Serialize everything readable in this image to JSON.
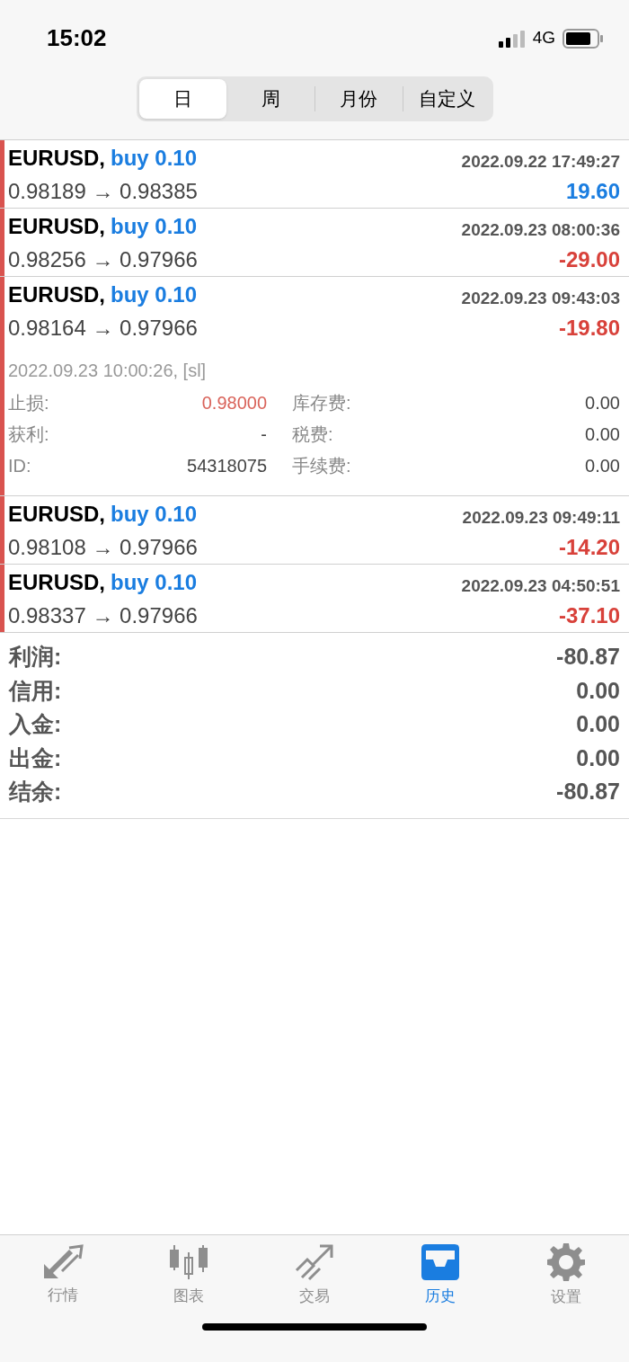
{
  "status_bar": {
    "time": "15:02",
    "network": "4G"
  },
  "tabs": [
    {
      "label": "日",
      "selected": true
    },
    {
      "label": "周",
      "selected": false
    },
    {
      "label": "月份",
      "selected": false
    },
    {
      "label": "自定义",
      "selected": false
    }
  ],
  "deals": [
    {
      "symbol": "EURUSD,",
      "side": "buy 0.10",
      "time": "2022.09.22 17:49:27",
      "prices": "0.98189 → 0.98385",
      "profit": "19.60",
      "positive": true
    },
    {
      "symbol": "EURUSD,",
      "side": "buy 0.10",
      "time": "2022.09.23 08:00:36",
      "prices": "0.98256 → 0.97966",
      "profit": "-29.00",
      "positive": false
    },
    {
      "symbol": "EURUSD,",
      "side": "buy 0.10",
      "time": "2022.09.23 09:43:03",
      "prices": "0.98164 → 0.97966",
      "profit": "-19.80",
      "positive": false,
      "details": {
        "close_info": "2022.09.23 10:00:26, [sl]",
        "fields": [
          {
            "label": "止损:",
            "value": "0.98000",
            "highlight": true
          },
          {
            "label": "库存费:",
            "value": "0.00",
            "highlight": false
          },
          {
            "label": "获利:",
            "value": "-",
            "highlight": false
          },
          {
            "label": "税费:",
            "value": "0.00",
            "highlight": false
          },
          {
            "label": "ID:",
            "value": "54318075",
            "highlight": false
          },
          {
            "label": "手续费:",
            "value": "0.00",
            "highlight": false
          }
        ]
      }
    },
    {
      "symbol": "EURUSD,",
      "side": "buy 0.10",
      "time": "2022.09.23 09:49:11",
      "prices": "0.98108 → 0.97966",
      "profit": "-14.20",
      "positive": false
    },
    {
      "symbol": "EURUSD,",
      "side": "buy 0.10",
      "time": "2022.09.23 04:50:51",
      "prices": "0.98337 → 0.97966",
      "profit": "-37.10",
      "positive": false
    }
  ],
  "summary": [
    {
      "label": "利润:",
      "value": "-80.87"
    },
    {
      "label": "信用:",
      "value": "0.00"
    },
    {
      "label": "入金:",
      "value": "0.00"
    },
    {
      "label": "出金:",
      "value": "0.00"
    },
    {
      "label": "结余:",
      "value": "-80.87"
    }
  ],
  "tab_bar": [
    {
      "label": "行情",
      "kind": "quotes",
      "selected": false
    },
    {
      "label": "图表",
      "kind": "chart",
      "selected": false
    },
    {
      "label": "交易",
      "kind": "trade",
      "selected": false
    },
    {
      "label": "历史",
      "kind": "history",
      "selected": true
    },
    {
      "label": "设置",
      "kind": "settings",
      "selected": false
    }
  ]
}
